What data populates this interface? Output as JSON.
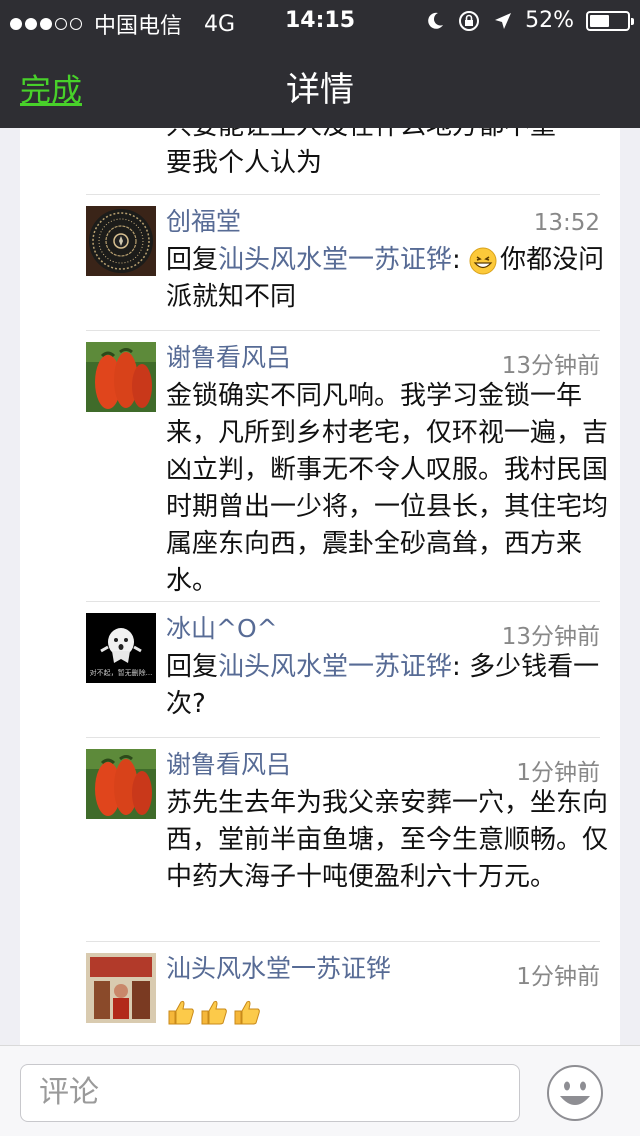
{
  "status_bar": {
    "carrier": "中国电信",
    "network": "4G",
    "time": "14:15",
    "battery": "52%",
    "battery_level": 0.52
  },
  "nav": {
    "done_label": "完成",
    "title": "详情"
  },
  "carryover_text": [
    "只要能让主人没在什么地方都不重",
    "要我个人认为"
  ],
  "comments": [
    {
      "name": "创福堂",
      "time": "13:52",
      "reply_prefix": "回复",
      "reply_to": "汕头风水堂一苏证铧",
      "text": "你都没问派就知不同"
    },
    {
      "name": "谢鲁看风吕",
      "time": "13分钟前",
      "text": "金锁确实不同凡响。我学习金锁一年来，凡所到乡村老宅，仅环视一遍，吉凶立判，断事无不令人叹服。我村民国时期曾出一少将，一位县长，其住宅均属座东向西，震卦全砂高耸，西方来水。"
    },
    {
      "name": "冰山^O^",
      "time": "13分钟前",
      "reply_prefix": "回复",
      "reply_to": "汕头风水堂一苏证铧",
      "text": "多少钱看一次?",
      "avatar_caption": "对不起，暂无删除..."
    },
    {
      "name": "谢鲁看风吕",
      "time": "1分钟前",
      "text": "苏先生去年为我父亲安葬一穴，坐东向西，堂前半亩鱼塘，至今生意顺畅。仅中药大海子十吨便盈利六十万元。"
    },
    {
      "name": "汕头风水堂一苏证铧",
      "time": "1分钟前",
      "emoji": [
        "thumbs-up",
        "thumbs-up",
        "thumbs-up"
      ]
    }
  ],
  "input": {
    "placeholder": "评论",
    "value": ""
  },
  "icons": [
    "signal-dots-icon",
    "moon-icon",
    "rotation-lock-icon",
    "location-arrow-icon",
    "battery-icon",
    "grin-emoji-icon",
    "thumbs-up-icon",
    "smiley-face-icon"
  ],
  "colors": {
    "bar_bg": "#2e2e33",
    "done_green": "#48d12a",
    "name_blue": "#576b95",
    "page_bg": "#efeff4"
  }
}
